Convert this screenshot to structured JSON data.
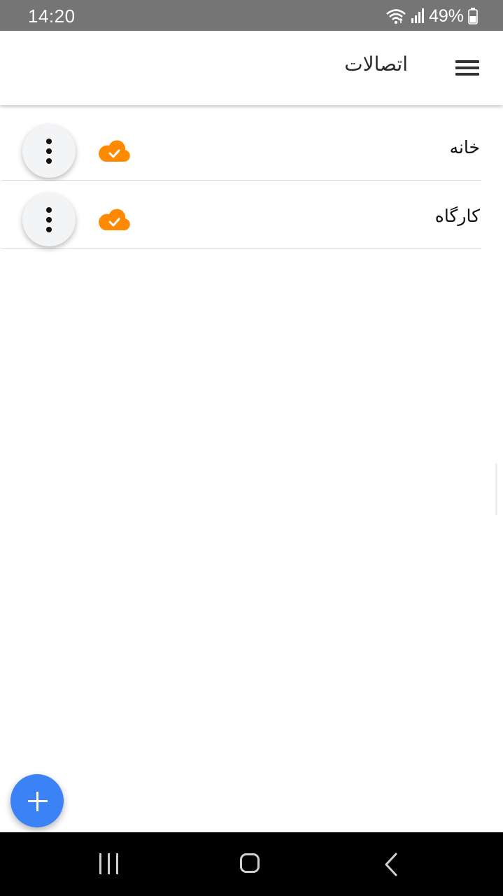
{
  "status_bar": {
    "time": "14:20",
    "battery_percent": "49%",
    "icons": [
      "wifi-icon",
      "signal-icon",
      "battery-icon"
    ]
  },
  "app_bar": {
    "title": "اتصالات",
    "menu_icon": "hamburger-menu-icon"
  },
  "connections": [
    {
      "name": "خانه",
      "status_icon": "cloud-check-icon",
      "status_color": "#FF8A00",
      "more_icon": "more-vertical-icon"
    },
    {
      "name": "کارگاه",
      "status_icon": "cloud-check-icon",
      "status_color": "#FF8A00",
      "more_icon": "more-vertical-icon"
    }
  ],
  "fab": {
    "icon": "plus-icon",
    "color": "#3B82F6"
  },
  "nav_bar": {
    "buttons": [
      "recent-apps-icon",
      "home-icon",
      "back-icon"
    ]
  }
}
